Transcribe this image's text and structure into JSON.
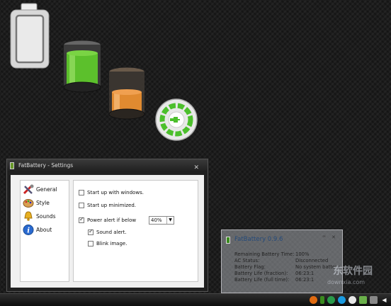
{
  "desktop_icons": [
    {
      "name": "empty-battery-icon"
    },
    {
      "name": "green-battery-icon"
    },
    {
      "name": "orange-battery-icon"
    },
    {
      "name": "power-plug-icon"
    }
  ],
  "settings_window": {
    "title": "FatBattery - Settings",
    "close_label": "✕",
    "nav": [
      {
        "label": "General",
        "icon": "tools-icon"
      },
      {
        "label": "Style",
        "icon": "palette-icon"
      },
      {
        "label": "Sounds",
        "icon": "bell-icon"
      },
      {
        "label": "About",
        "icon": "info-icon"
      }
    ],
    "options": {
      "startup_windows": {
        "label": "Start up with windows.",
        "checked": false
      },
      "startup_minimized": {
        "label": "Start up minimized.",
        "checked": false
      },
      "power_alert": {
        "label": "Power alert if below",
        "checked": true
      },
      "power_alert_value": "40%",
      "sound_alert": {
        "label": "Sound alert.",
        "checked": true
      },
      "blink_image": {
        "label": "Blink image.",
        "checked": false
      }
    }
  },
  "info_panel": {
    "title": "FatBattery 0.9.6",
    "buttons": "ꟹ ✕",
    "rows": [
      {
        "key": "Remaining Battery Time:",
        "value": "100%"
      },
      {
        "key": "AC Status:",
        "value": "Disconnected"
      },
      {
        "key": "Battery Flag:",
        "value": "No system battery"
      },
      {
        "key": "Battery Life (fraction):",
        "value": "06:23:1"
      },
      {
        "key": "Battery Life (full time):",
        "value": "06:23:1"
      }
    ]
  },
  "watermark": {
    "line1": "东软件园",
    "line2": "downxia.com"
  },
  "taskbar": {
    "tray_icons": [
      "firefox-icon",
      "battery-icon",
      "app-icon",
      "network-icon",
      "shield-icon",
      "clock-icon",
      "display-icon",
      "volume-icon"
    ]
  },
  "colors": {
    "accent_green": "#5cc02c",
    "accent_orange": "#e08a30",
    "title_blue": "#244a7a"
  }
}
